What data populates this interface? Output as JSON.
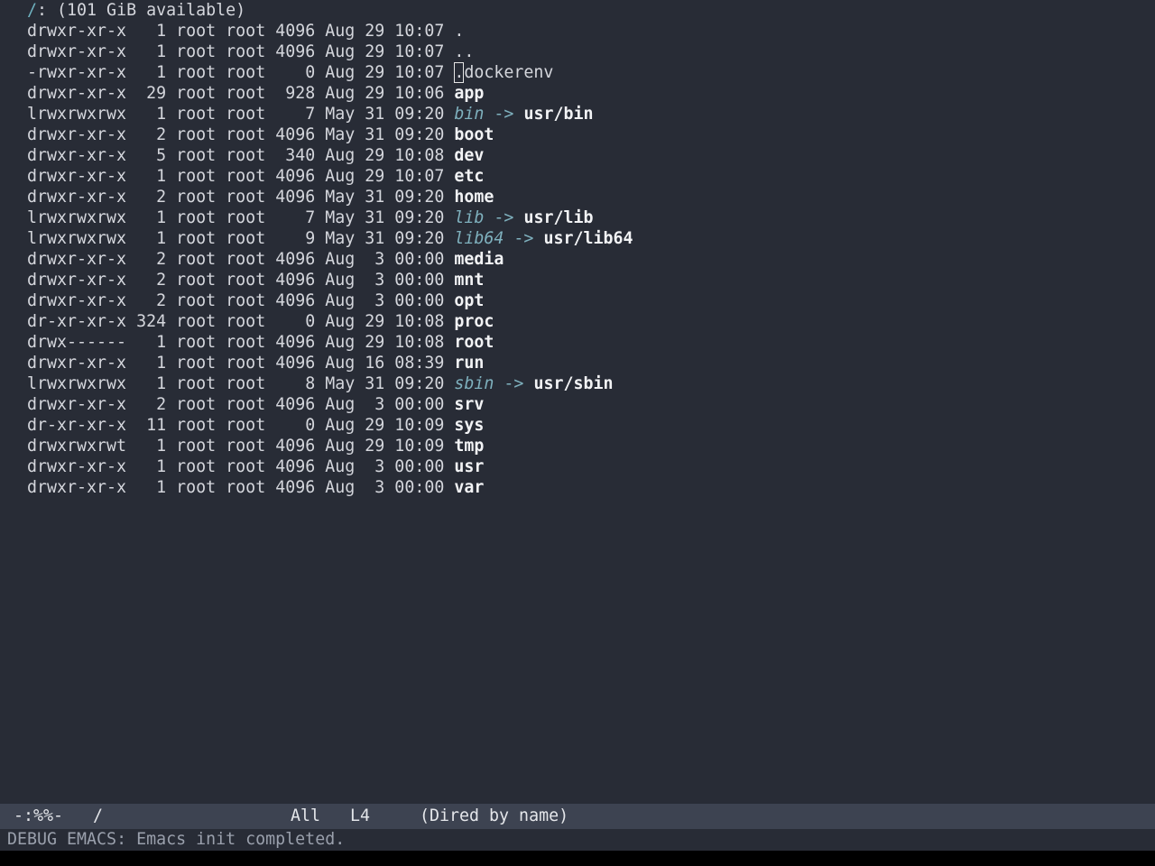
{
  "header": {
    "slash": "/",
    "text": ": (101 GiB available)"
  },
  "entries": [
    {
      "perm": "drwxr-xr-x",
      "links": "  1",
      "owner": "root",
      "group": "root",
      "size": "4096",
      "date": "Aug 29 10:07",
      "name": ".",
      "kind": "dir"
    },
    {
      "perm": "drwxr-xr-x",
      "links": "  1",
      "owner": "root",
      "group": "root",
      "size": "4096",
      "date": "Aug 29 10:07",
      "name": "..",
      "kind": "dir"
    },
    {
      "perm": "-rwxr-xr-x",
      "links": "  1",
      "owner": "root",
      "group": "root",
      "size": "   0",
      "date": "Aug 29 10:07",
      "name": ".dockerenv",
      "kind": "file"
    },
    {
      "perm": "drwxr-xr-x",
      "links": " 29",
      "owner": "root",
      "group": "root",
      "size": " 928",
      "date": "Aug 29 10:06",
      "name": "app",
      "kind": "dir"
    },
    {
      "perm": "lrwxrwxrwx",
      "links": "  1",
      "owner": "root",
      "group": "root",
      "size": "   7",
      "date": "May 31 09:20",
      "name": "bin",
      "kind": "link",
      "target": "usr/bin"
    },
    {
      "perm": "drwxr-xr-x",
      "links": "  2",
      "owner": "root",
      "group": "root",
      "size": "4096",
      "date": "May 31 09:20",
      "name": "boot",
      "kind": "dir"
    },
    {
      "perm": "drwxr-xr-x",
      "links": "  5",
      "owner": "root",
      "group": "root",
      "size": " 340",
      "date": "Aug 29 10:08",
      "name": "dev",
      "kind": "dir"
    },
    {
      "perm": "drwxr-xr-x",
      "links": "  1",
      "owner": "root",
      "group": "root",
      "size": "4096",
      "date": "Aug 29 10:07",
      "name": "etc",
      "kind": "dir"
    },
    {
      "perm": "drwxr-xr-x",
      "links": "  2",
      "owner": "root",
      "group": "root",
      "size": "4096",
      "date": "May 31 09:20",
      "name": "home",
      "kind": "dir"
    },
    {
      "perm": "lrwxrwxrwx",
      "links": "  1",
      "owner": "root",
      "group": "root",
      "size": "   7",
      "date": "May 31 09:20",
      "name": "lib",
      "kind": "link",
      "target": "usr/lib"
    },
    {
      "perm": "lrwxrwxrwx",
      "links": "  1",
      "owner": "root",
      "group": "root",
      "size": "   9",
      "date": "May 31 09:20",
      "name": "lib64",
      "kind": "link",
      "target": "usr/lib64"
    },
    {
      "perm": "drwxr-xr-x",
      "links": "  2",
      "owner": "root",
      "group": "root",
      "size": "4096",
      "date": "Aug  3 00:00",
      "name": "media",
      "kind": "dir"
    },
    {
      "perm": "drwxr-xr-x",
      "links": "  2",
      "owner": "root",
      "group": "root",
      "size": "4096",
      "date": "Aug  3 00:00",
      "name": "mnt",
      "kind": "dir"
    },
    {
      "perm": "drwxr-xr-x",
      "links": "  2",
      "owner": "root",
      "group": "root",
      "size": "4096",
      "date": "Aug  3 00:00",
      "name": "opt",
      "kind": "dir"
    },
    {
      "perm": "dr-xr-xr-x",
      "links": "324",
      "owner": "root",
      "group": "root",
      "size": "   0",
      "date": "Aug 29 10:08",
      "name": "proc",
      "kind": "dir"
    },
    {
      "perm": "drwx------",
      "links": "  1",
      "owner": "root",
      "group": "root",
      "size": "4096",
      "date": "Aug 29 10:08",
      "name": "root",
      "kind": "dir"
    },
    {
      "perm": "drwxr-xr-x",
      "links": "  1",
      "owner": "root",
      "group": "root",
      "size": "4096",
      "date": "Aug 16 08:39",
      "name": "run",
      "kind": "dir"
    },
    {
      "perm": "lrwxrwxrwx",
      "links": "  1",
      "owner": "root",
      "group": "root",
      "size": "   8",
      "date": "May 31 09:20",
      "name": "sbin",
      "kind": "link",
      "target": "usr/sbin"
    },
    {
      "perm": "drwxr-xr-x",
      "links": "  2",
      "owner": "root",
      "group": "root",
      "size": "4096",
      "date": "Aug  3 00:00",
      "name": "srv",
      "kind": "dir"
    },
    {
      "perm": "dr-xr-xr-x",
      "links": " 11",
      "owner": "root",
      "group": "root",
      "size": "   0",
      "date": "Aug 29 10:09",
      "name": "sys",
      "kind": "dir"
    },
    {
      "perm": "drwxrwxrwt",
      "links": "  1",
      "owner": "root",
      "group": "root",
      "size": "4096",
      "date": "Aug 29 10:09",
      "name": "tmp",
      "kind": "dir"
    },
    {
      "perm": "drwxr-xr-x",
      "links": "  1",
      "owner": "root",
      "group": "root",
      "size": "4096",
      "date": "Aug  3 00:00",
      "name": "usr",
      "kind": "dir"
    },
    {
      "perm": "drwxr-xr-x",
      "links": "  1",
      "owner": "root",
      "group": "root",
      "size": "4096",
      "date": "Aug  3 00:00",
      "name": "var",
      "kind": "dir"
    }
  ],
  "link_arrow": "->",
  "modeline": {
    "status": "-:%%-",
    "buffer": "/",
    "position": "All",
    "line": "L4",
    "mode": "(Dired by name)"
  },
  "echo_area": {
    "message": "DEBUG EMACS: Emacs init completed."
  },
  "colors": {
    "background": "#282c36",
    "modeline_bg": "#3d4351",
    "directory": "#f2f3f5",
    "symlink": "#7fb1be"
  }
}
